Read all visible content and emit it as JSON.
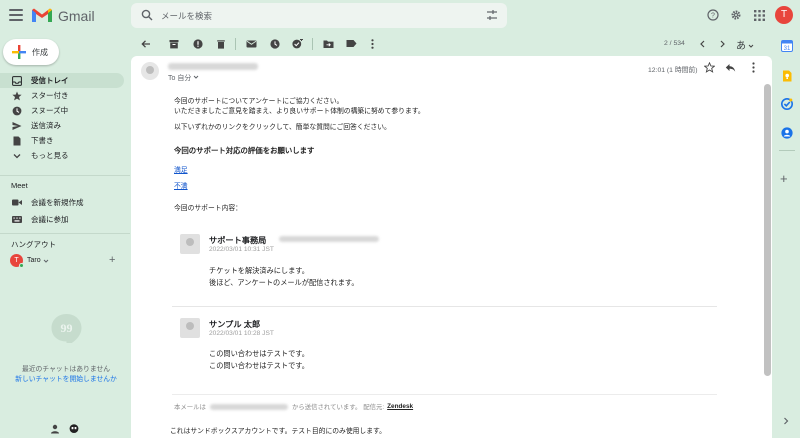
{
  "app": {
    "brand": "Gmail",
    "user_initial": "T"
  },
  "search": {
    "placeholder": "メールを検索"
  },
  "compose": {
    "label": "作成"
  },
  "nav": {
    "items": [
      {
        "label": "受信トレイ",
        "icon": "inbox-icon",
        "active": true
      },
      {
        "label": "スター付き",
        "icon": "star-icon"
      },
      {
        "label": "スヌーズ中",
        "icon": "clock-icon"
      },
      {
        "label": "送信済み",
        "icon": "send-icon"
      },
      {
        "label": "下書き",
        "icon": "draft-icon"
      },
      {
        "label": "もっと見る",
        "icon": "chevron-down-icon"
      }
    ]
  },
  "meet": {
    "title": "Meet",
    "new_meeting": "会議を新規作成",
    "join_meeting": "会議に参加"
  },
  "hangouts": {
    "title": "ハングアウト",
    "user": "Taro",
    "no_chat": "最近のチャットはありません",
    "start_chat": "新しいチャットを開始しませんか"
  },
  "toolbar": {
    "pager": "2 / 534",
    "input_tool": "あ"
  },
  "email": {
    "to_label": "To 自分",
    "timestamp": "12:01 (1 時間前)",
    "para1_line1": "今回のサポートについてアンケートにご協力ください。",
    "para1_line2": "いただきましたご意見を踏まえ、より良いサポート体制の構築に努めて参ります。",
    "para2": "以下いずれかのリンクをクリックして、簡単な質問にご回答ください。",
    "heading": "今回のサポート対応の評価をお願いします",
    "link_good": "満足",
    "link_bad": "不満",
    "support_label": "今回のサポート内容：",
    "messages": [
      {
        "name": "サポート事務局",
        "date": "2022/03/01 10:31 JST",
        "line1": "チケットを解決済みにします。",
        "line2": "後ほど、アンケートのメールが配信されます。"
      },
      {
        "name": "サンプル 太郎",
        "date": "2022/03/01 10:28 JST",
        "line1": "この問い合わせはテストです。",
        "line2": "この問い合わせはテストです。"
      }
    ],
    "footer_prefix": "本メールは",
    "footer_mid": "から送信されています。 配信元:",
    "footer_link": "Zendesk",
    "sandbox": "これはサンドボックスアカウントです。テスト目的にのみ使用します。"
  },
  "colors": {
    "bg": "#d9ede0",
    "accent_red": "#e8453c",
    "link": "#1155cc"
  }
}
